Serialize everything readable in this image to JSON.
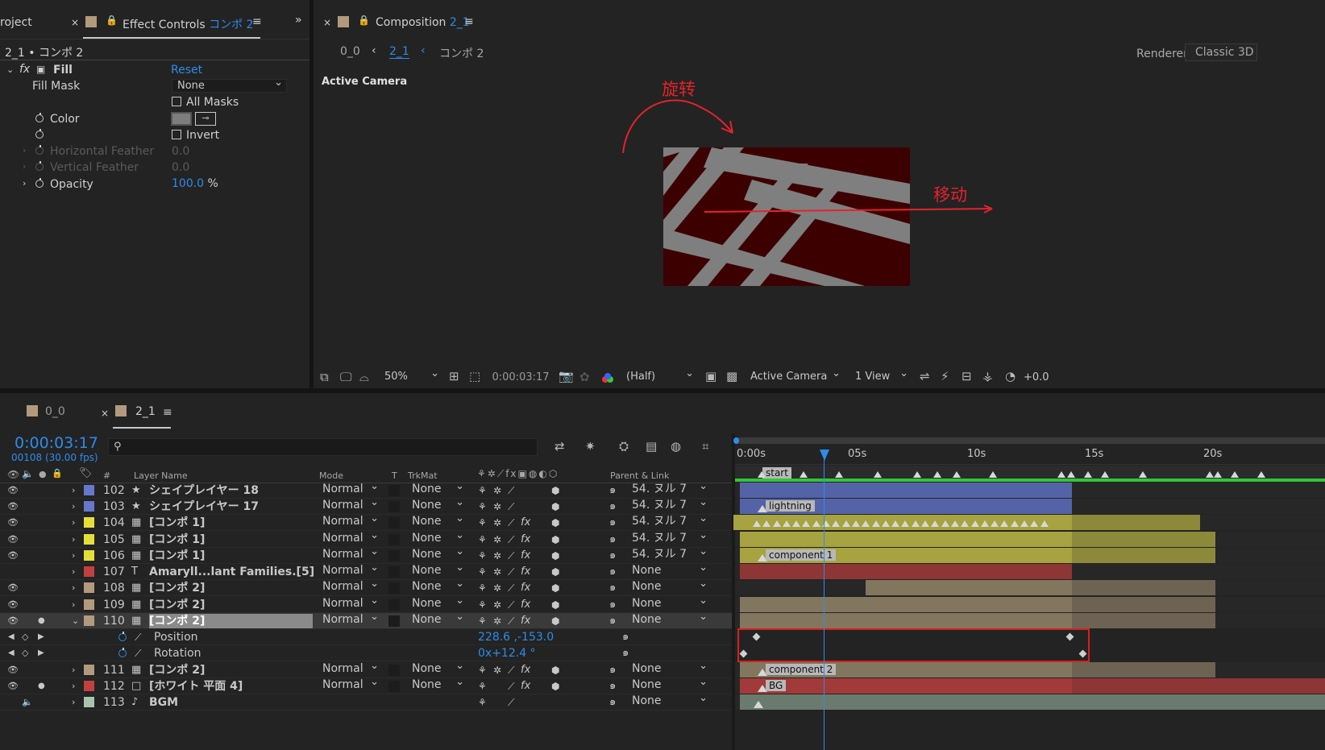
{
  "left_panel": {
    "project_tab": "roject",
    "effect_tab": "Effect Controls",
    "effect_target": "コンポ 2",
    "breadcrumb": "2_1 • コンポ 2",
    "effect_name": "Fill",
    "reset": "Reset",
    "props": {
      "fill_mask": "Fill Mask",
      "fill_mask_value": "None",
      "all_masks": "All Masks",
      "color": "Color",
      "invert": "Invert",
      "h_feather": "Horizontal Feather",
      "h_feather_value": "0.0",
      "v_feather": "Vertical Feather",
      "v_feather_value": "0.0",
      "opacity": "Opacity",
      "opacity_value": "100.0",
      "opacity_unit": "%"
    }
  },
  "comp_panel": {
    "tab": "Composition",
    "tab_name": "2_1",
    "crumb_a": "0_0",
    "crumb_b": "2_1",
    "crumb_c": "コンポ 2",
    "renderer_label": "Renderer:",
    "renderer_value": "Classic 3D",
    "active_camera": "Active Camera",
    "annot_rotate": "旋转",
    "annot_move": "移动",
    "annot_color": "#e3232b",
    "toolbar": {
      "zoom": "50%",
      "time": "0:00:03:17",
      "quality": "(Half)",
      "camera": "Active Camera",
      "views": "1 View",
      "exposure": "+0.0"
    }
  },
  "timeline": {
    "tab_a": "0_0",
    "tab_b": "2_1",
    "timecode": "0:00:03:17",
    "frames": "00108 (30.00 fps)",
    "col_hash": "#",
    "col_layer": "Layer Name",
    "col_mode": "Mode",
    "col_t": "T",
    "col_trkmat": "TrkMat",
    "col_parent": "Parent & Link",
    "ruler": [
      "0:00s",
      "05s",
      "10s",
      "15s",
      "20s"
    ],
    "layers": [
      {
        "num": "102",
        "icon": "★",
        "name": "シェイプレイヤー 18",
        "mode": "Normal",
        "trk": "None",
        "parent": "54. ヌル 7",
        "color": "#6677cc",
        "fx": false,
        "eye": true
      },
      {
        "num": "103",
        "icon": "★",
        "name": "シェイプレイヤー 17",
        "mode": "Normal",
        "trk": "None",
        "parent": "54. ヌル 7",
        "color": "#6677cc",
        "fx": false,
        "eye": true
      },
      {
        "num": "104",
        "icon": "▦",
        "name": "[コンポ 1]",
        "mode": "Normal",
        "trk": "None",
        "parent": "54. ヌル 7",
        "color": "#e6df3a",
        "fx": true,
        "eye": true
      },
      {
        "num": "105",
        "icon": "▦",
        "name": "[コンポ 1]",
        "mode": "Normal",
        "trk": "None",
        "parent": "54. ヌル 7",
        "color": "#e6df3a",
        "fx": true,
        "eye": true
      },
      {
        "num": "106",
        "icon": "▦",
        "name": "[コンポ 1]",
        "mode": "Normal",
        "trk": "None",
        "parent": "54. ヌル 7",
        "color": "#e6df3a",
        "fx": true,
        "eye": true
      },
      {
        "num": "107",
        "icon": "T",
        "name": "Amaryll...lant Families.[5]",
        "mode": "Normal",
        "trk": "None",
        "parent": "None",
        "color": "#c44040",
        "fx": true,
        "eye": false
      },
      {
        "num": "108",
        "icon": "▦",
        "name": "[コンポ 2]",
        "mode": "Normal",
        "trk": "None",
        "parent": "None",
        "color": "#b39a7e",
        "fx": true,
        "eye": true
      },
      {
        "num": "109",
        "icon": "▦",
        "name": "[コンポ 2]",
        "mode": "Normal",
        "trk": "None",
        "parent": "None",
        "color": "#b39a7e",
        "fx": true,
        "eye": true
      },
      {
        "num": "110",
        "icon": "▦",
        "name": "[コンポ 2]",
        "mode": "Normal",
        "trk": "None",
        "parent": "None",
        "color": "#b39a7e",
        "fx": true,
        "eye": true
      },
      {
        "num": "111",
        "icon": "▦",
        "name": "[コンポ 2]",
        "mode": "Normal",
        "trk": "None",
        "parent": "None",
        "color": "#b39a7e",
        "fx": true,
        "eye": true
      },
      {
        "num": "112",
        "icon": "□",
        "name": "[ホワイト 平面 4]",
        "mode": "Normal",
        "trk": "None",
        "parent": "None",
        "color": "#c44040",
        "fx": true,
        "eye": true
      },
      {
        "num": "113",
        "icon": "♪",
        "name": "BGM",
        "mode": "",
        "trk": "",
        "parent": "None",
        "color": "#a7c4ac",
        "fx": false,
        "eye": false
      }
    ],
    "props": [
      {
        "name": "Position",
        "value": "228.6 ,-153.0"
      },
      {
        "name": "Rotation",
        "value": "0x+12.4 °"
      }
    ],
    "markers": {
      "start": "start",
      "lightning": "lightning",
      "component1": "component 1",
      "component2": "component 2",
      "bg": "BG"
    }
  }
}
